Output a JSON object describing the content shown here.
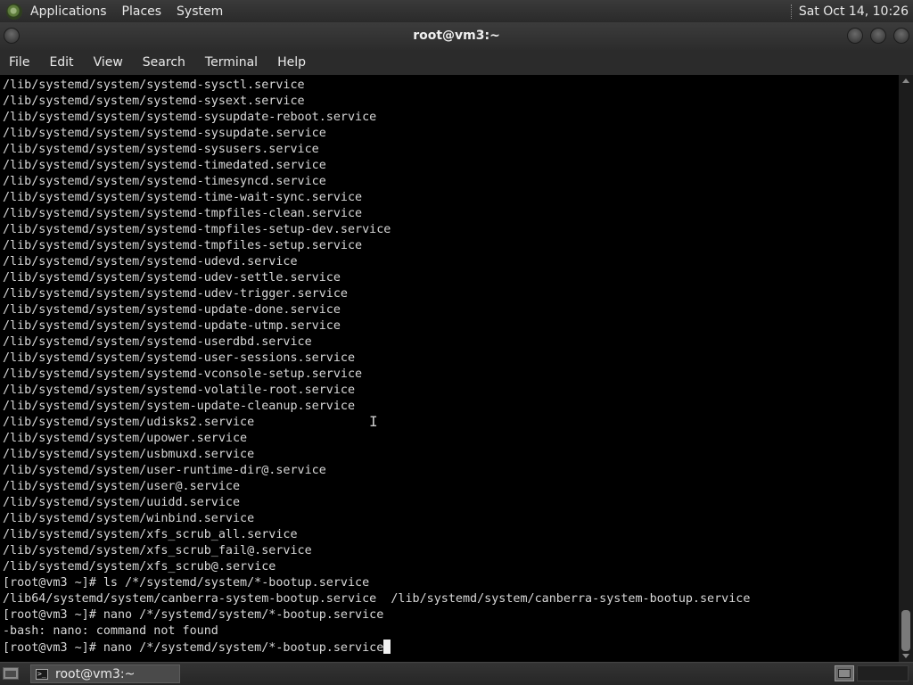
{
  "top_panel": {
    "menus": [
      "Applications",
      "Places",
      "System"
    ],
    "clock": "Sat Oct 14, 10:26"
  },
  "window": {
    "title": "root@vm3:~"
  },
  "menubar": [
    "File",
    "Edit",
    "View",
    "Search",
    "Terminal",
    "Help"
  ],
  "terminal": {
    "lines": [
      "/lib/systemd/system/systemd-sysctl.service",
      "/lib/systemd/system/systemd-sysext.service",
      "/lib/systemd/system/systemd-sysupdate-reboot.service",
      "/lib/systemd/system/systemd-sysupdate.service",
      "/lib/systemd/system/systemd-sysusers.service",
      "/lib/systemd/system/systemd-timedated.service",
      "/lib/systemd/system/systemd-timesyncd.service",
      "/lib/systemd/system/systemd-time-wait-sync.service",
      "/lib/systemd/system/systemd-tmpfiles-clean.service",
      "/lib/systemd/system/systemd-tmpfiles-setup-dev.service",
      "/lib/systemd/system/systemd-tmpfiles-setup.service",
      "/lib/systemd/system/systemd-udevd.service",
      "/lib/systemd/system/systemd-udev-settle.service",
      "/lib/systemd/system/systemd-udev-trigger.service",
      "/lib/systemd/system/systemd-update-done.service",
      "/lib/systemd/system/systemd-update-utmp.service",
      "/lib/systemd/system/systemd-userdbd.service",
      "/lib/systemd/system/systemd-user-sessions.service",
      "/lib/systemd/system/systemd-vconsole-setup.service",
      "/lib/systemd/system/systemd-volatile-root.service",
      "/lib/systemd/system/system-update-cleanup.service",
      "/lib/systemd/system/udisks2.service",
      "/lib/systemd/system/upower.service",
      "/lib/systemd/system/usbmuxd.service",
      "/lib/systemd/system/user-runtime-dir@.service",
      "/lib/systemd/system/user@.service",
      "/lib/systemd/system/uuidd.service",
      "/lib/systemd/system/winbind.service",
      "/lib/systemd/system/xfs_scrub_all.service",
      "/lib/systemd/system/xfs_scrub_fail@.service",
      "/lib/systemd/system/xfs_scrub@.service",
      "[root@vm3 ~]# ls /*/systemd/system/*-bootup.service",
      "/lib64/systemd/system/canberra-system-bootup.service  /lib/systemd/system/canberra-system-bootup.service",
      "[root@vm3 ~]# nano /*/systemd/system/*-bootup.service",
      "-bash: nano: command not found",
      "[root@vm3 ~]# nano /*/systemd/system/*-bootup.service"
    ]
  },
  "taskbar": {
    "task_label": "root@vm3:~",
    "task_icon_glyph": ">_"
  }
}
